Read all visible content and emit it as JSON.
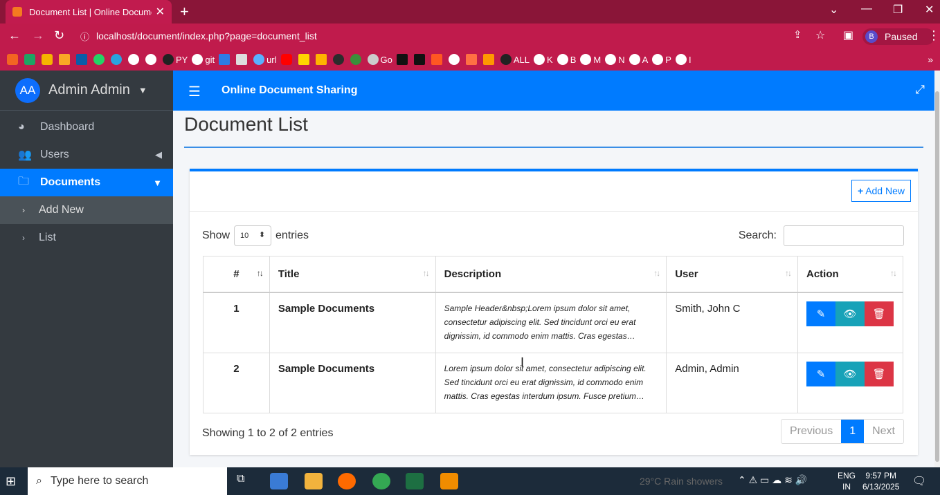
{
  "browser": {
    "tab_title": "Document List | Online Documen",
    "url": "localhost/document/index.php?page=document_list",
    "profile_initial": "B",
    "profile_status": "Paused",
    "bookmarks": [
      "PY",
      "git",
      "url",
      "Go",
      "ALL",
      "K",
      "B",
      "M",
      "N",
      "A",
      "P",
      "I"
    ]
  },
  "sidebar": {
    "avatar_initials": "AA",
    "user_name": "Admin Admin",
    "items": [
      {
        "label": "Dashboard"
      },
      {
        "label": "Users"
      },
      {
        "label": "Documents"
      },
      {
        "label": "Add New"
      },
      {
        "label": "List"
      }
    ]
  },
  "topnav": {
    "title": "Online Document Sharing"
  },
  "page": {
    "title": "Document List"
  },
  "card": {
    "add_new_label": "Add New",
    "show_label": "Show",
    "entries_label": "entries",
    "page_size": "10",
    "search_label": "Search:",
    "columns": [
      "#",
      "Title",
      "Description",
      "User",
      "Action"
    ],
    "rows": [
      {
        "num": "1",
        "title": "Sample Documents",
        "description": "Sample Header&nbsp;Lorem ipsum dolor sit amet, consectetur adipiscing elit. Sed tincidunt orci eu erat dignissim, id commodo enim mattis. Cras egestas…",
        "user": "Smith, John C"
      },
      {
        "num": "2",
        "title": "Sample Documents",
        "description": "Lorem ipsum dolor sit amet, consectetur adipiscing elit. Sed tincidunt orci eu erat dignissim, id commodo enim mattis. Cras egestas interdum ipsum. Fusce pretium…",
        "user": "Admin, Admin"
      }
    ],
    "showing_text": "Showing 1 to 2 of 2 entries",
    "pager": {
      "previous": "Previous",
      "current": "1",
      "next": "Next"
    }
  },
  "taskbar": {
    "search_placeholder": "Type here to search",
    "weather": "29°C  Rain showers",
    "lang_line1": "ENG",
    "lang_line2": "IN",
    "time": "9:57 PM",
    "date": "6/13/2025"
  },
  "colors": {
    "primary": "#007bff",
    "sidebar": "#343a40",
    "chrome": "#c01b4c",
    "danger": "#dc3545",
    "info": "#17a2b8"
  }
}
